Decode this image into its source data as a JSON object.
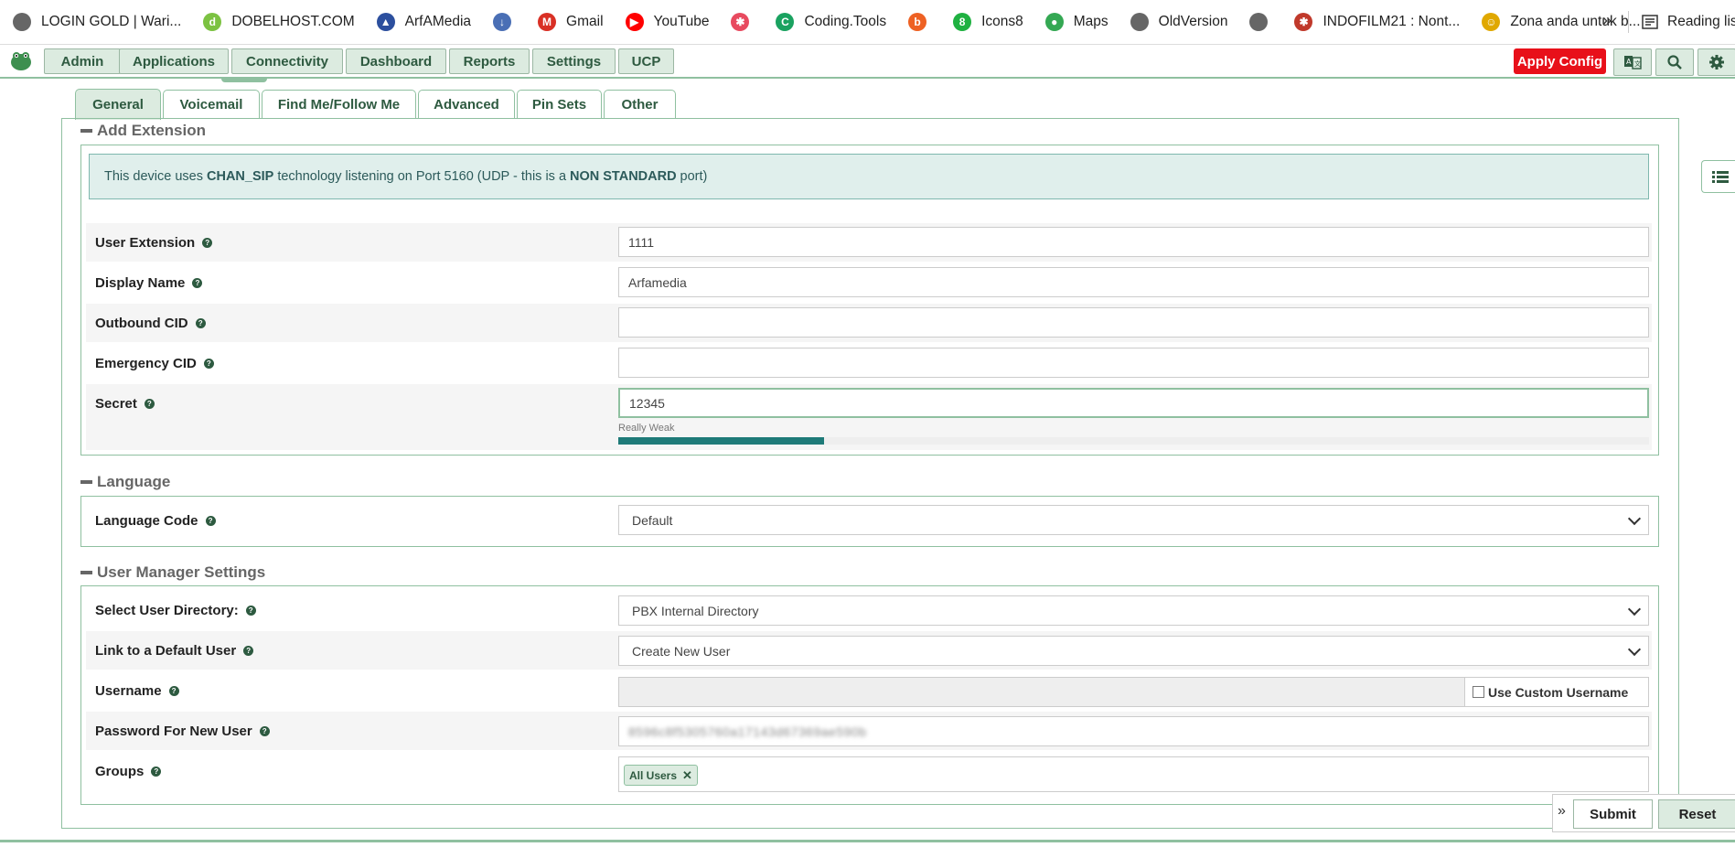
{
  "bookmarks": [
    {
      "label": "LOGIN GOLD | Wari...",
      "icon": "globe-icon"
    },
    {
      "label": "DOBELHOST.COM",
      "icon": "dobelhost-icon"
    },
    {
      "label": "ArfAMedia",
      "icon": "arfamedia-icon"
    },
    {
      "label": "",
      "icon": "download-icon"
    },
    {
      "label": "Gmail",
      "icon": "gmail-icon"
    },
    {
      "label": "YouTube",
      "icon": "youtube-icon"
    },
    {
      "label": "",
      "icon": "pinwheel-icon"
    },
    {
      "label": "Coding.Tools",
      "icon": "coding-tools-icon"
    },
    {
      "label": "",
      "icon": "bitly-icon"
    },
    {
      "label": "Icons8",
      "icon": "icons8-icon"
    },
    {
      "label": "Maps",
      "icon": "maps-icon"
    },
    {
      "label": "OldVersion",
      "icon": "globe-icon"
    },
    {
      "label": "",
      "icon": "globe-icon"
    },
    {
      "label": "INDOFILM21 : Nont...",
      "icon": "indofilm-icon"
    },
    {
      "label": "Zona anda untuk b...",
      "icon": "zona-icon"
    }
  ],
  "bookmarks_more": "»",
  "reading_list": "Reading lis",
  "nav": {
    "items": [
      "Admin",
      "Applications",
      "Connectivity",
      "Dashboard",
      "Reports",
      "Settings",
      "UCP"
    ],
    "apply_config": "Apply Config"
  },
  "tabs": [
    "General",
    "Voicemail",
    "Find Me/Follow Me",
    "Advanced",
    "Pin Sets",
    "Other"
  ],
  "add_extension": {
    "title": "Add Extension",
    "alert": {
      "pre": "This device uses",
      "tech": "CHAN_SIP",
      "mid": "technology listening on Port 5160 (UDP - this is a",
      "nonstd": "NON STANDARD",
      "post": "port)"
    },
    "fields": {
      "user_extension": {
        "label": "User Extension",
        "value": "1111"
      },
      "display_name": {
        "label": "Display Name",
        "value": "Arfamedia"
      },
      "outbound_cid": {
        "label": "Outbound CID",
        "value": ""
      },
      "emergency_cid": {
        "label": "Emergency CID",
        "value": ""
      },
      "secret": {
        "label": "Secret",
        "value": "12345"
      }
    },
    "strength": {
      "label": "Really Weak",
      "fraction": 0.2
    }
  },
  "language": {
    "title": "Language",
    "code_label": "Language Code",
    "code_value": "Default"
  },
  "user_manager": {
    "title": "User Manager Settings",
    "directory_label": "Select User Directory:",
    "directory_value": "PBX Internal Directory",
    "link_label": "Link to a Default User",
    "link_value": "Create New User",
    "username_label": "Username",
    "username_value": "",
    "custom_username": "Use Custom Username",
    "password_label": "Password For New User",
    "password_value": "8596c8f5305760a17143d67369ae590b",
    "groups_label": "Groups",
    "group_tag": "All Users"
  },
  "actions": {
    "toggle": "»",
    "submit": "Submit",
    "reset": "Reset"
  }
}
